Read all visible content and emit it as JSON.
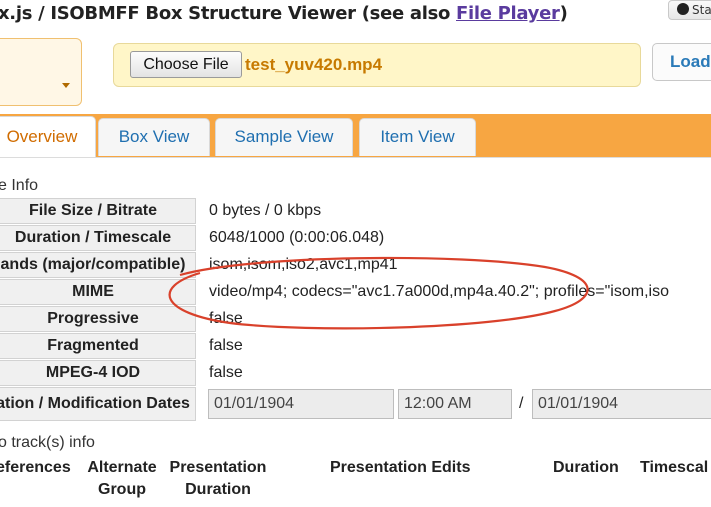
{
  "header": {
    "title_prefix": "x.js / ISOBMFF Box Structure Viewer (see also ",
    "title_link": "File Player",
    "title_suffix": ")",
    "github_label": "Sta"
  },
  "file_input": {
    "choose_label": "Choose File",
    "filename": "test_yuv420.mp4",
    "load_label": "Load"
  },
  "tabs": [
    {
      "label": "Overview",
      "active": true
    },
    {
      "label": "Box View"
    },
    {
      "label": "Sample View"
    },
    {
      "label": "Item View"
    }
  ],
  "file_info": {
    "section_label": "e Info",
    "rows": [
      {
        "label": "File Size / Bitrate",
        "value": "0 bytes / 0 kbps"
      },
      {
        "label": "Duration / Timescale",
        "value": "6048/1000 (0:00:06.048)"
      },
      {
        "label": "ands (major/compatible)",
        "value": "isom,isom,iso2,avc1,mp41"
      },
      {
        "label": "MIME",
        "value": "video/mp4; codecs=\"avc1.7a000d,mp4a.40.2\"; profiles=\"isom,iso"
      },
      {
        "label": "Progressive",
        "value": "false"
      },
      {
        "label": "Fragmented",
        "value": "false"
      },
      {
        "label": "MPEG-4 IOD",
        "value": "false"
      }
    ],
    "dates": {
      "label": "ation / Modification Dates",
      "creation_date": "01/01/1904",
      "creation_time": "12:00 AM",
      "separator": "/",
      "modification_date": "01/01/1904"
    }
  },
  "tracks": {
    "section_label": "o track(s) info",
    "headers": {
      "references": "eferences",
      "alternate_group_1": "Alternate",
      "alternate_group_2": "Group",
      "presentation_duration_1": "Presentation",
      "presentation_duration_2": "Duration",
      "presentation_edits": "Presentation Edits",
      "duration": "Duration",
      "timescale": "Timescal"
    }
  },
  "colors": {
    "tab_bar": "#f7a642",
    "tab_active_text": "#d06c00",
    "tab_text": "#1f6fb0",
    "filename": "#c77a00",
    "annotation_oval": "#d9412b"
  }
}
